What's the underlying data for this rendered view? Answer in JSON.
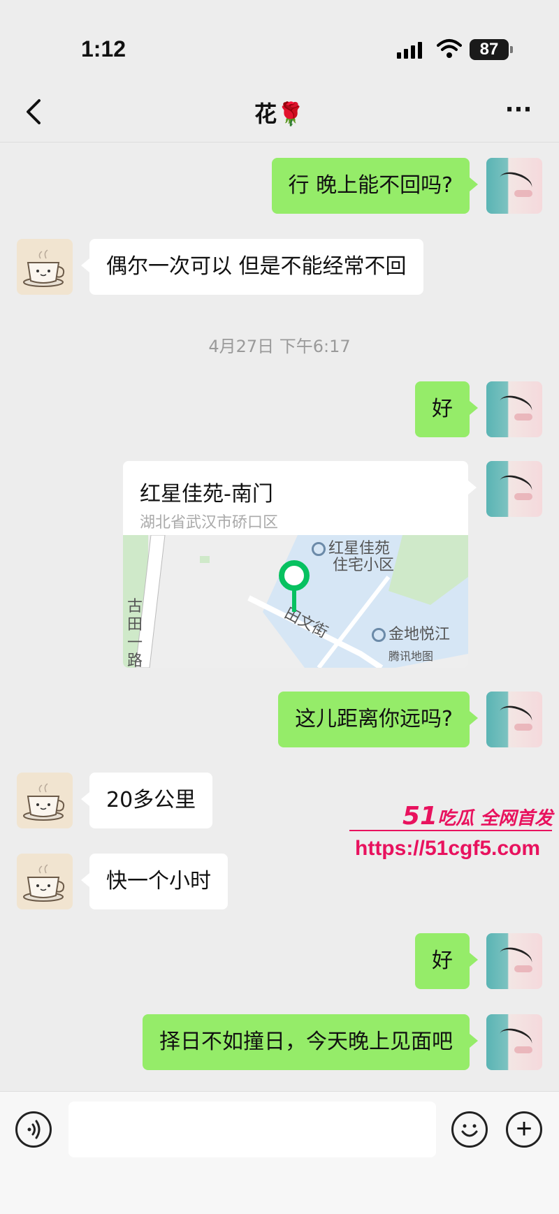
{
  "status_bar": {
    "time": "1:12",
    "battery": "87"
  },
  "header": {
    "title": "花🌹",
    "back_icon": "chevron-left-icon",
    "more_icon": "more-dots-icon"
  },
  "messages": [
    {
      "side": "mine",
      "text": "行 晚上能不回吗?"
    },
    {
      "side": "theirs",
      "text": "偶尔一次可以 但是不能经常不回"
    },
    {
      "side": "mine",
      "text": "好"
    },
    {
      "side": "mine",
      "text": "这儿距离你远吗?"
    },
    {
      "side": "theirs",
      "text": "20多公里"
    },
    {
      "side": "theirs",
      "text": "快一个小时"
    },
    {
      "side": "mine",
      "text": "好"
    },
    {
      "side": "mine",
      "text": "择日不如撞日，今天晚上见面吧"
    }
  ],
  "timestamp": "4月27日 下午6:17",
  "location": {
    "title": "红星佳苑-南门",
    "address": "湖北省武汉市硚口区",
    "map_labels": {
      "poi1_line1": "红星佳苑",
      "poi1_line2": "住宅小区",
      "street": "田文街",
      "road": "古田一路",
      "poi2": "金地悦江",
      "provider": "腾讯地图"
    }
  },
  "watermark": {
    "brand": "51",
    "tagline": "吃瓜 全网首发",
    "url": "https://51cgf5.com"
  },
  "input_bar": {
    "placeholder": "",
    "voice_icon": "voice-icon",
    "emoji_icon": "emoji-icon",
    "plus_icon": "plus-icon"
  }
}
